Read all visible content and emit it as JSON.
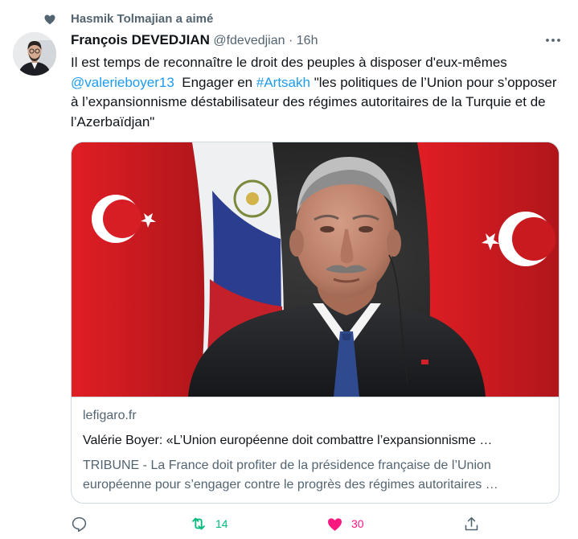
{
  "social_context": {
    "text": "Hasmik Tolmajian a aimé",
    "icon": "heart-icon"
  },
  "tweet": {
    "author_name": "François DEVEDJIAN",
    "handle": "@fdevedjian",
    "separator": "·",
    "time": "16h",
    "text": {
      "line1": "Il est temps de reconnaître le droit des peuples à disposer d'eux-mêmes",
      "mention": "@valerieboyer13",
      "mid": "Engager en",
      "hashtag": "#Artsakh",
      "rest": "\"les politiques de l’Union pour s’opposer à l’expansionnisme déstabilisateur des régimes autoritaires de la Turquie et de l’Azerbaïdjan\""
    }
  },
  "card": {
    "domain": "lefigaro.fr",
    "title": "Valérie Boyer: «L’Union européenne doit combattre l’expansionnisme …",
    "description": "TRIBUNE - La France doit profiter de la présidence française de l’Union européenne pour s’engager contre le progrès des régimes autoritaires …"
  },
  "actions": {
    "reply": {
      "icon": "reply-icon",
      "count": ""
    },
    "retweet": {
      "icon": "retweet-icon",
      "count": "14",
      "color": "#00ba7c"
    },
    "like": {
      "icon": "heart-filled-icon",
      "count": "30",
      "color": "#f91880"
    },
    "share": {
      "icon": "share-icon"
    }
  },
  "colors": {
    "link": "#1d9bf0",
    "secondary_text": "#536471",
    "border": "#cfd9de"
  }
}
